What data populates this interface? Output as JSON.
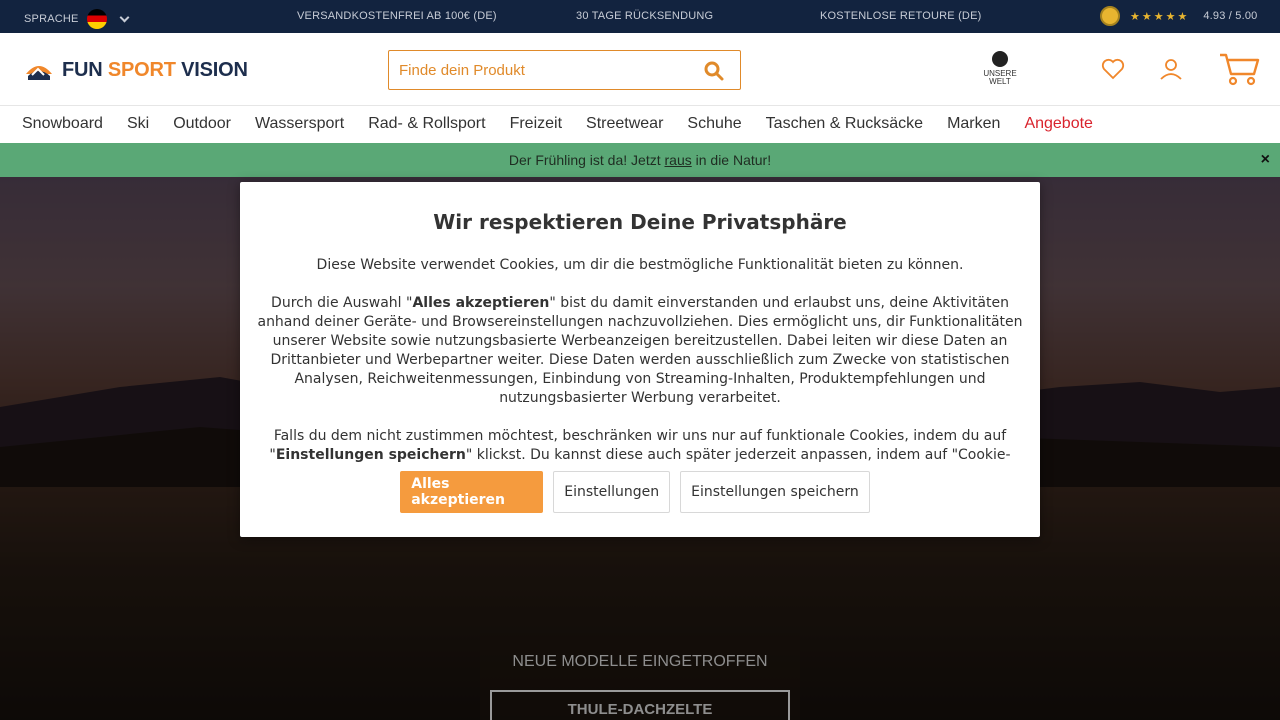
{
  "topbar": {
    "language_label": "Sprache",
    "usps": [
      "Versandkostenfrei ab 100€ (DE)",
      "30 Tage Rücksendung",
      "Kostenlose Retoure (DE)"
    ],
    "rating_stars": "★★★★★",
    "rating_value": "4.93 / 5.00"
  },
  "header": {
    "logo_part1": "FUN ",
    "logo_part2": "SPORT",
    "logo_part3": " VISION",
    "search_placeholder": "Finde dein Produkt",
    "unsere_welt_line1": "UNSERE",
    "unsere_welt_line2": "WELT"
  },
  "nav": {
    "items": [
      "Snowboard",
      "Ski",
      "Outdoor",
      "Wassersport",
      "Rad- & Rollsport",
      "Freizeit",
      "Streetwear",
      "Schuhe",
      "Taschen & Rucksäcke",
      "Marken",
      "Angebote"
    ]
  },
  "promo": {
    "text_before": "Der Frühling ist da! Jetzt ",
    "link": "raus",
    "text_after": " in die Natur!",
    "close": "×"
  },
  "hero": {
    "kicker": "Neue Modelle eingetroffen",
    "cta": "Thule-Dachzelte"
  },
  "modal": {
    "title": "Wir respektieren Deine Privatsphäre",
    "p1": "Diese Website verwendet Cookies, um dir die bestmögliche Funktionalität bieten zu können.",
    "p2_before": "Durch die Auswahl \"",
    "p2_bold": "Alles akzeptieren",
    "p2_after": "\" bist du damit einverstanden und erlaubst uns, deine Aktivitäten anhand deiner Geräte- und Browsereinstellungen nachzuvollziehen. Dies ermöglicht uns, dir Funktionalitäten unserer Website sowie nutzungsbasierte Werbeanzeigen bereitzustellen. Dabei leiten wir diese Daten an Drittanbieter und Werbepartner weiter. Diese Daten werden ausschließlich zum Zwecke von statistischen Analysen, Reichweitenmessungen, Einbindung von Streaming-Inhalten, Produktempfehlungen und nutzungsbasierter Werbung verarbeitet.",
    "p3_before": "Falls du dem nicht zustimmen möchtest, beschränken wir uns nur auf funktionale Cookies, indem du auf \"",
    "p3_bold": "Einstellungen speichern",
    "p3_after": "\" klickst. Du kannst diese auch später jederzeit anpassen, indem auf \"Cookie-",
    "btn_accept": "Alles akzeptieren",
    "btn_settings": "Einstellungen",
    "btn_save": "Einstellungen speichern"
  },
  "colors": {
    "topbar_bg": "#12233f",
    "accent_orange": "#f59b3e",
    "promo_green": "#5aa876",
    "offer_red": "#d9232d"
  }
}
